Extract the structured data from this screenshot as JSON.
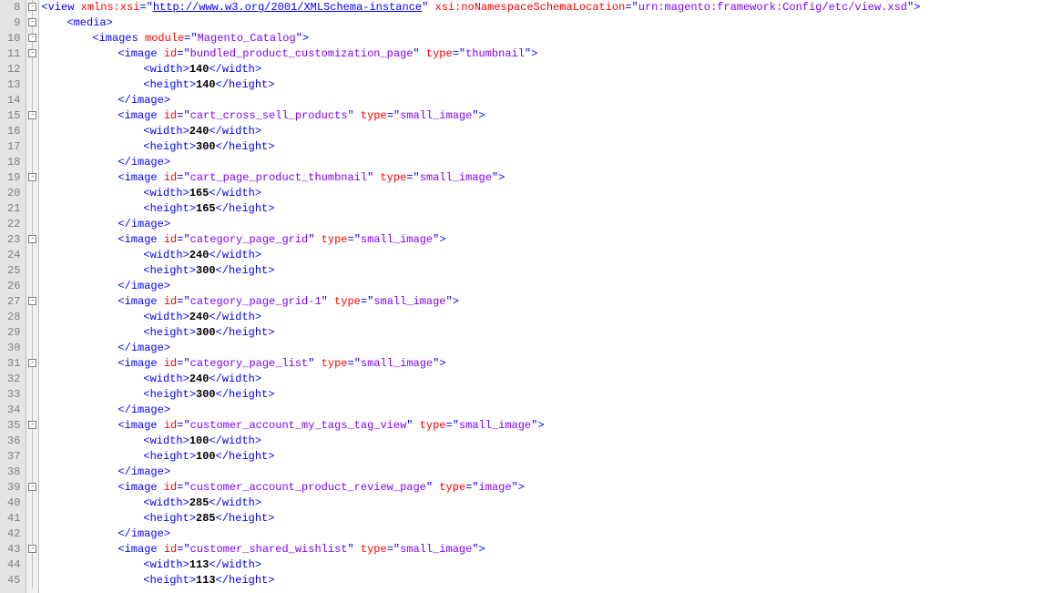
{
  "startLine": 8,
  "attrNames": {
    "xmlns": "xmlns:xsi",
    "nsloc": "xsi:noNamespaceSchemaLocation",
    "module": "module",
    "id": "id",
    "type": "type"
  },
  "view": {
    "xmlns": "http://www.w3.org/2001/XMLSchema-instance",
    "nsloc": "urn:magento:framework:Config/etc/view.xsd"
  },
  "imagesModule": "Magento_Catalog",
  "tags": {
    "view": "view",
    "media": "media",
    "images": "images",
    "image": "image",
    "width": "width",
    "height": "height"
  },
  "images": [
    {
      "id": "bundled_product_customization_page",
      "type": "thumbnail",
      "width": "140",
      "height": "140"
    },
    {
      "id": "cart_cross_sell_products",
      "type": "small_image",
      "width": "240",
      "height": "300"
    },
    {
      "id": "cart_page_product_thumbnail",
      "type": "small_image",
      "width": "165",
      "height": "165"
    },
    {
      "id": "category_page_grid",
      "type": "small_image",
      "width": "240",
      "height": "300"
    },
    {
      "id": "category_page_grid-1",
      "type": "small_image",
      "width": "240",
      "height": "300"
    },
    {
      "id": "category_page_list",
      "type": "small_image",
      "width": "240",
      "height": "300"
    },
    {
      "id": "customer_account_my_tags_tag_view",
      "type": "small_image",
      "width": "100",
      "height": "100"
    },
    {
      "id": "customer_account_product_review_page",
      "type": "image",
      "width": "285",
      "height": "285"
    },
    {
      "id": "customer_shared_wishlist",
      "type": "small_image",
      "width": "113",
      "height": "113"
    }
  ]
}
